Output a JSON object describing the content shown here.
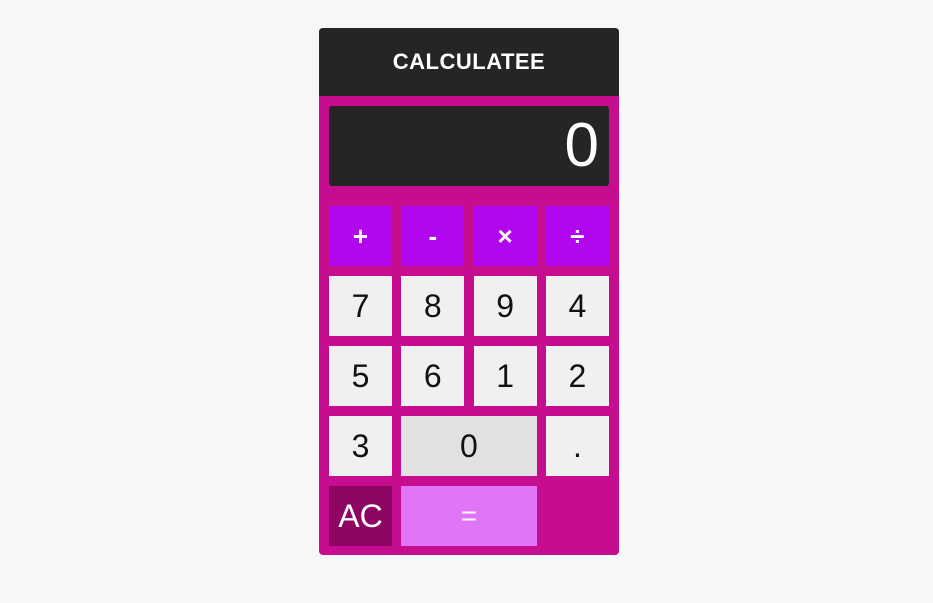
{
  "header": {
    "title": "CALCULATEE"
  },
  "display": {
    "value": "0"
  },
  "keys": {
    "operators": [
      "+",
      "-",
      "×",
      "÷"
    ],
    "row1": [
      "7",
      "8",
      "9",
      "4"
    ],
    "row2": [
      "5",
      "6",
      "1",
      "2"
    ],
    "row3": [
      "3",
      "0",
      "."
    ],
    "row4": [
      "AC",
      "="
    ]
  },
  "colors": {
    "body": "#c60d8f",
    "header": "#252525",
    "operator": "#b107ee",
    "clear": "#8e0664",
    "equals": "#e075f8",
    "digit": "#f0f0f0",
    "zero": "#e1e1e1",
    "background": "#f7f7f7"
  }
}
